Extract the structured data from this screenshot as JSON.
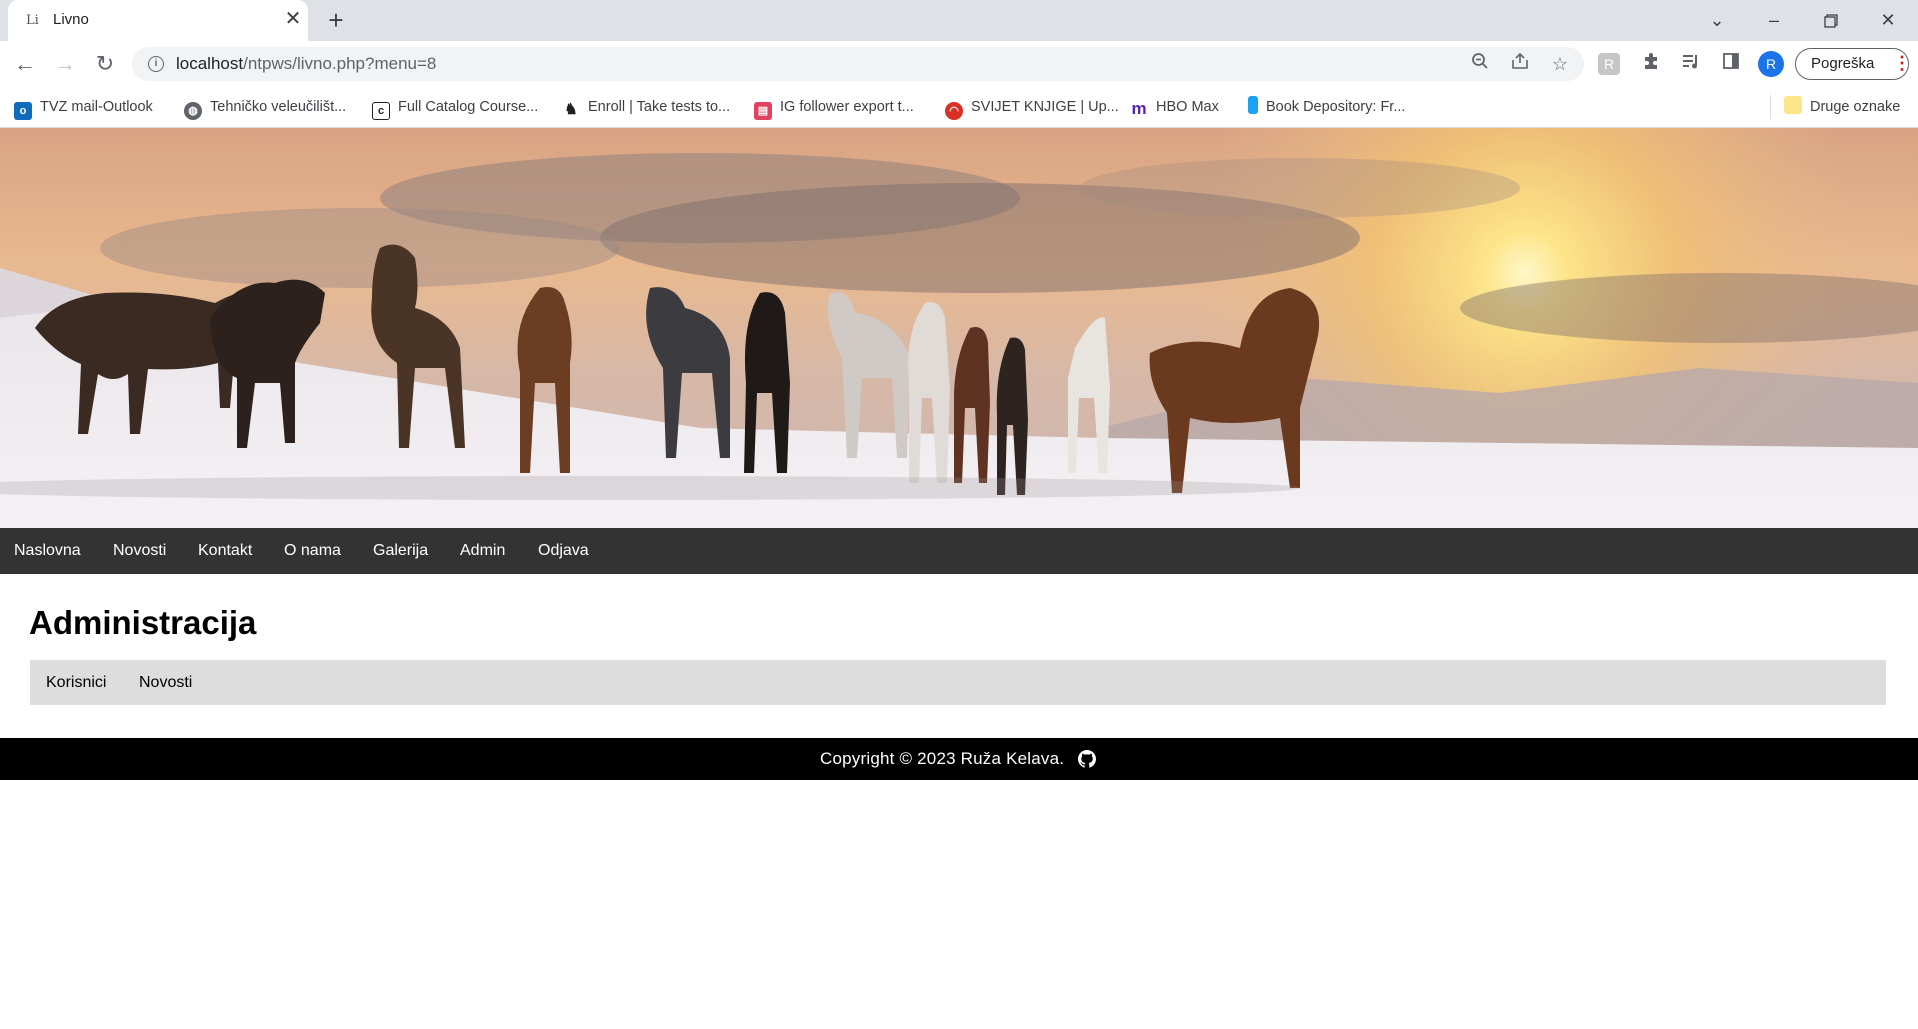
{
  "browser": {
    "tab_title": "Livno",
    "tab_favicon": "Li",
    "url_host": "localhost",
    "url_path": "/ntpws/livno.php?menu=8",
    "profile_initial": "R",
    "error_button": "Pogreška"
  },
  "bookmarks": [
    {
      "label": "TVZ mail-Outlook",
      "icon": "outlook-icon",
      "color": "#0f6cbd"
    },
    {
      "label": "Tehničko veleučilišt...",
      "icon": "globe-icon",
      "color": "#5f6368"
    },
    {
      "label": "Full Catalog Course...",
      "icon": "catalog-icon",
      "color": "#202124"
    },
    {
      "label": "Enroll | Take tests to...",
      "icon": "horse-icon",
      "color": "#202124"
    },
    {
      "label": "IG follower export t...",
      "icon": "ig-export-icon",
      "color": "#e4405f"
    },
    {
      "label": "SVIJET KNJIGE | Up...",
      "icon": "lips-icon",
      "color": "#d93025"
    },
    {
      "label": "HBO Max",
      "icon": "hbo-max-icon",
      "color": "#5822b4"
    },
    {
      "label": "Book Depository: Fr...",
      "icon": "book-icon",
      "color": "#1da1f2"
    }
  ],
  "other_bookmarks": "Druge oznake",
  "nav": [
    "Naslovna",
    "Novosti",
    "Kontakt",
    "O nama",
    "Galerija",
    "Admin",
    "Odjava"
  ],
  "page": {
    "title": "Administracija",
    "subnav": [
      "Korisnici",
      "Novosti"
    ]
  },
  "footer": {
    "text": "Copyright © 2023 Ruža Kelava."
  }
}
